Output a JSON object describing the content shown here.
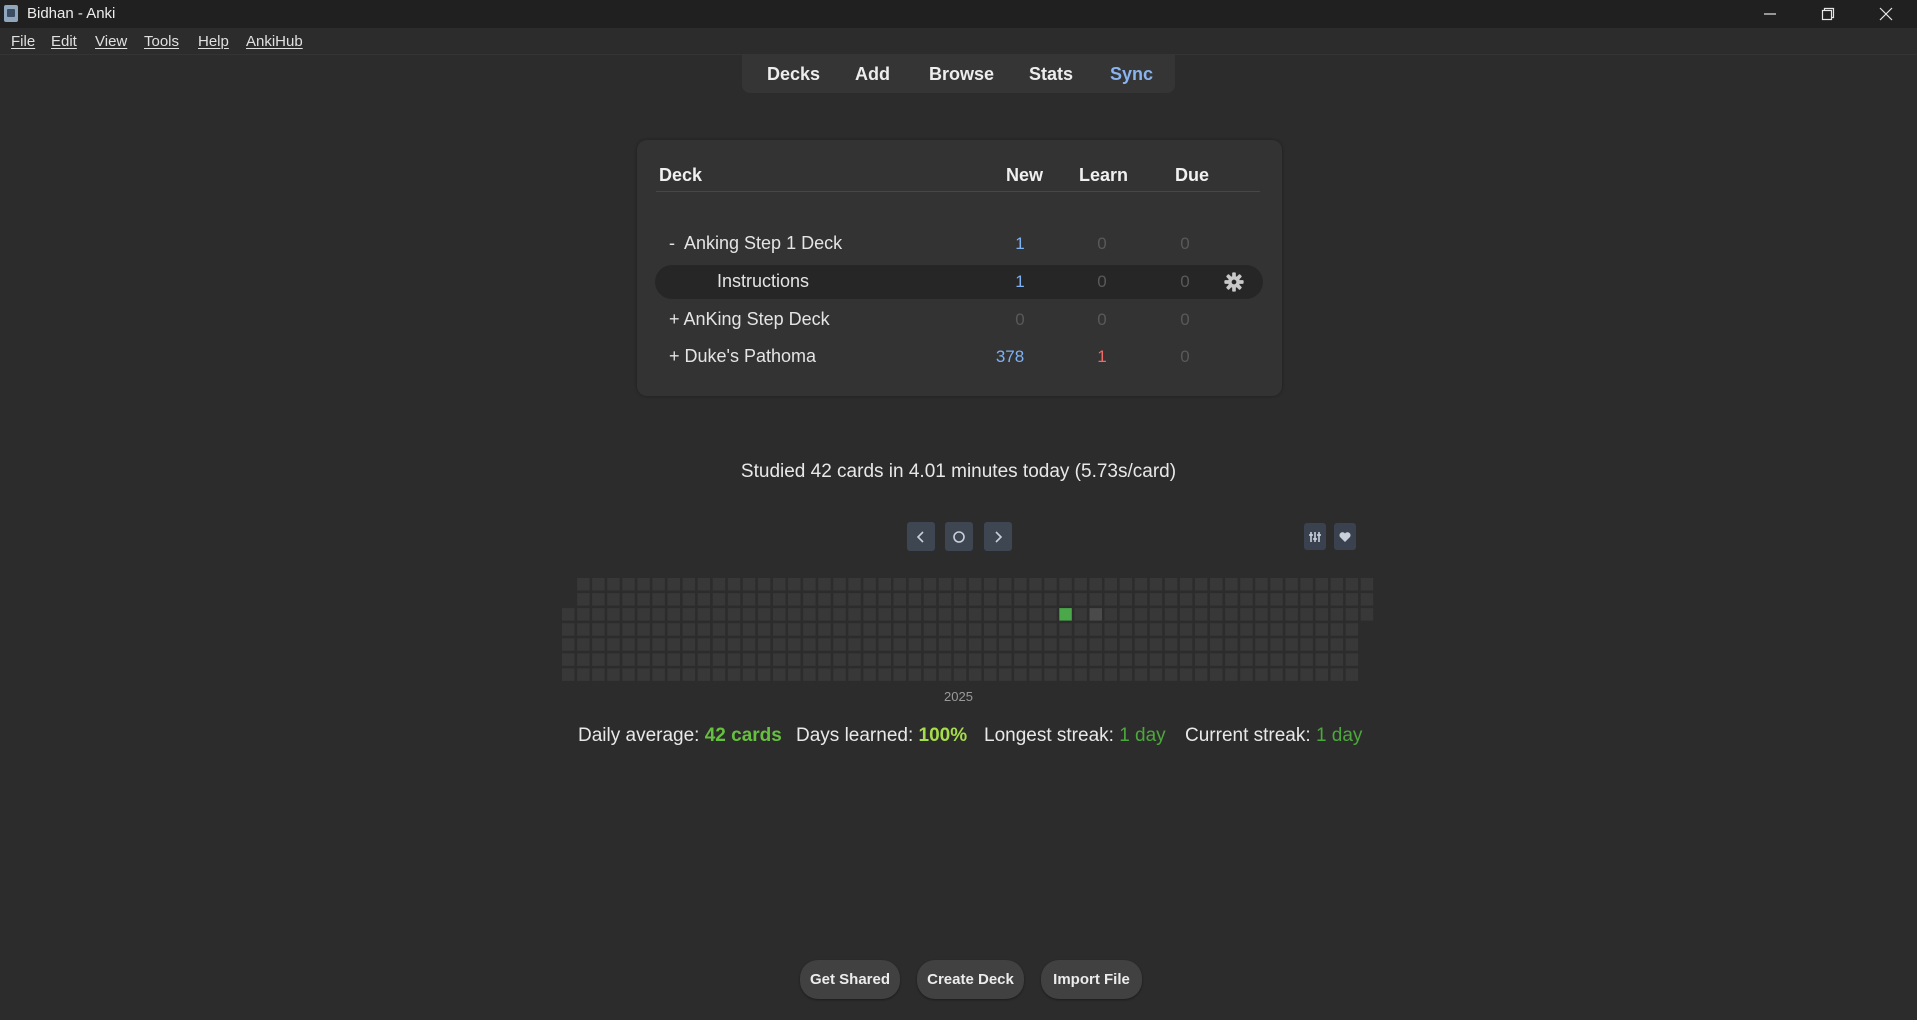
{
  "window": {
    "title": "Bidhan - Anki",
    "icon": "anki-app-icon"
  },
  "menu": [
    "File",
    "Edit",
    "View",
    "Tools",
    "Help",
    "AnkiHub"
  ],
  "toolbar": [
    "Decks",
    "Add",
    "Browse",
    "Stats",
    "Sync"
  ],
  "deck_table": {
    "headers": {
      "deck": "Deck",
      "new": "New",
      "learn": "Learn",
      "due": "Due"
    },
    "rows": [
      {
        "name": "-  Anking Step 1 Deck",
        "new": "1",
        "learn": "0",
        "due": "0"
      },
      {
        "name": "Instructions",
        "new": "1",
        "learn": "0",
        "due": "0",
        "current": true
      },
      {
        "name": "+ AnKing Step Deck",
        "new": "0",
        "learn": "0",
        "due": "0"
      },
      {
        "name": "+ Duke's Pathoma",
        "new": "378",
        "learn": "1",
        "due": "0"
      }
    ]
  },
  "studied": "Studied 42 cards in 4.01 minutes today (5.73s/card)",
  "heatmap": {
    "year": "2025",
    "active_color": "#4aa84a",
    "today_color": "#4a4a4a",
    "empty_color": "#383838"
  },
  "stats": {
    "daily_average_label": "Daily average: ",
    "daily_average_value": "42 cards",
    "days_learned_label": "Days learned: ",
    "days_learned_value": "100%",
    "longest_streak_label": "Longest streak: ",
    "longest_streak_value": "1 day",
    "current_streak_label": "Current streak: ",
    "current_streak_value": "1 day"
  },
  "bottom_buttons": [
    "Get Shared",
    "Create Deck",
    "Import File"
  ],
  "colors": {
    "accent_new": "#7fb2f2",
    "accent_learn": "#f06a6a",
    "sync": "#8ab4ee"
  }
}
